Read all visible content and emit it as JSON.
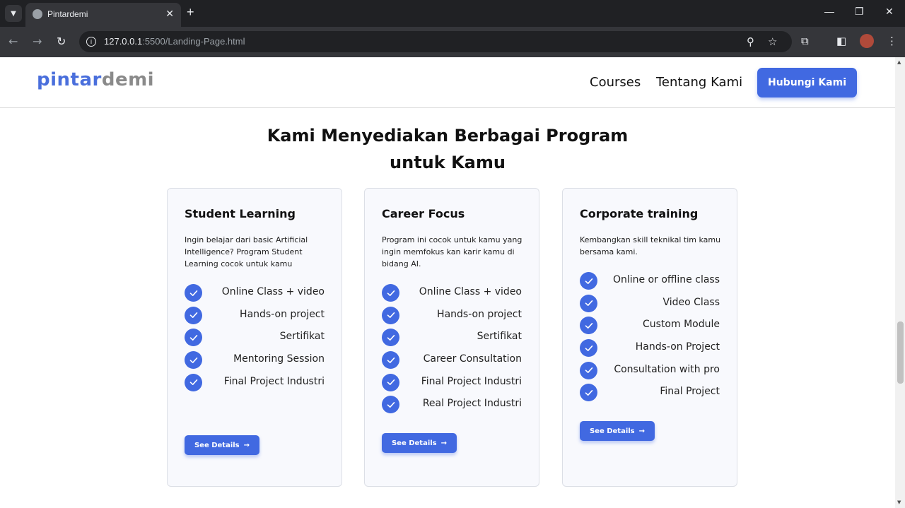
{
  "browser": {
    "tab_title": "Pintardemi",
    "tab_close": "✕",
    "new_tab": "+",
    "url_host": "127.0.0.1",
    "url_rest": ":5500/Landing-Page.html",
    "icons": [
      "tab-search-icon",
      "favicon-icon",
      "back-icon",
      "forward-icon",
      "reload-icon",
      "site-info-icon",
      "zoom-icon",
      "bookmark-star-icon",
      "extensions-icon",
      "side-panel-icon",
      "profile-avatar",
      "menu-icon",
      "minimize-icon",
      "restore-icon",
      "close-window-icon"
    ]
  },
  "nav": {
    "logo_part1": "pintar",
    "logo_part2": "demi",
    "links": [
      "Courses",
      "Tentang Kami"
    ],
    "cta": "Hubungi Kami"
  },
  "section": {
    "heading_line1": "Kami Menyediakan Berbagai Program",
    "heading_line2": "untuk Kamu"
  },
  "cards": [
    {
      "title": "Student Learning",
      "description": "Ingin belajar dari basic Artificial Intelligence? Program Student Learning cocok untuk kamu",
      "features": [
        "Online Class + video",
        "Hands-on project",
        "Sertifikat",
        "Mentoring Session",
        "Final Project Industri"
      ],
      "button": "See Details"
    },
    {
      "title": "Career Focus",
      "description": "Program ini cocok untuk kamu yang ingin memfokus kan karir kamu di bidang AI.",
      "features": [
        "Online Class + video",
        "Hands-on project",
        "Sertifikat",
        "Career Consultation",
        "Final Project Industri",
        "Real Project Industri"
      ],
      "button": "See Details"
    },
    {
      "title": "Corporate training",
      "description": "Kembangkan skill teknikal tim kamu bersama kami.",
      "features": [
        "Online or offline class",
        "Video Class",
        "Custom Module",
        "Hands-on Project",
        "Consultation with pro",
        "Final Project"
      ],
      "button": "See Details"
    }
  ],
  "colors": {
    "accent": "#4169e1",
    "logo_blue": "#4a6fdc",
    "logo_grey": "#8a8a8a",
    "card_bg": "#f8f9fd"
  }
}
